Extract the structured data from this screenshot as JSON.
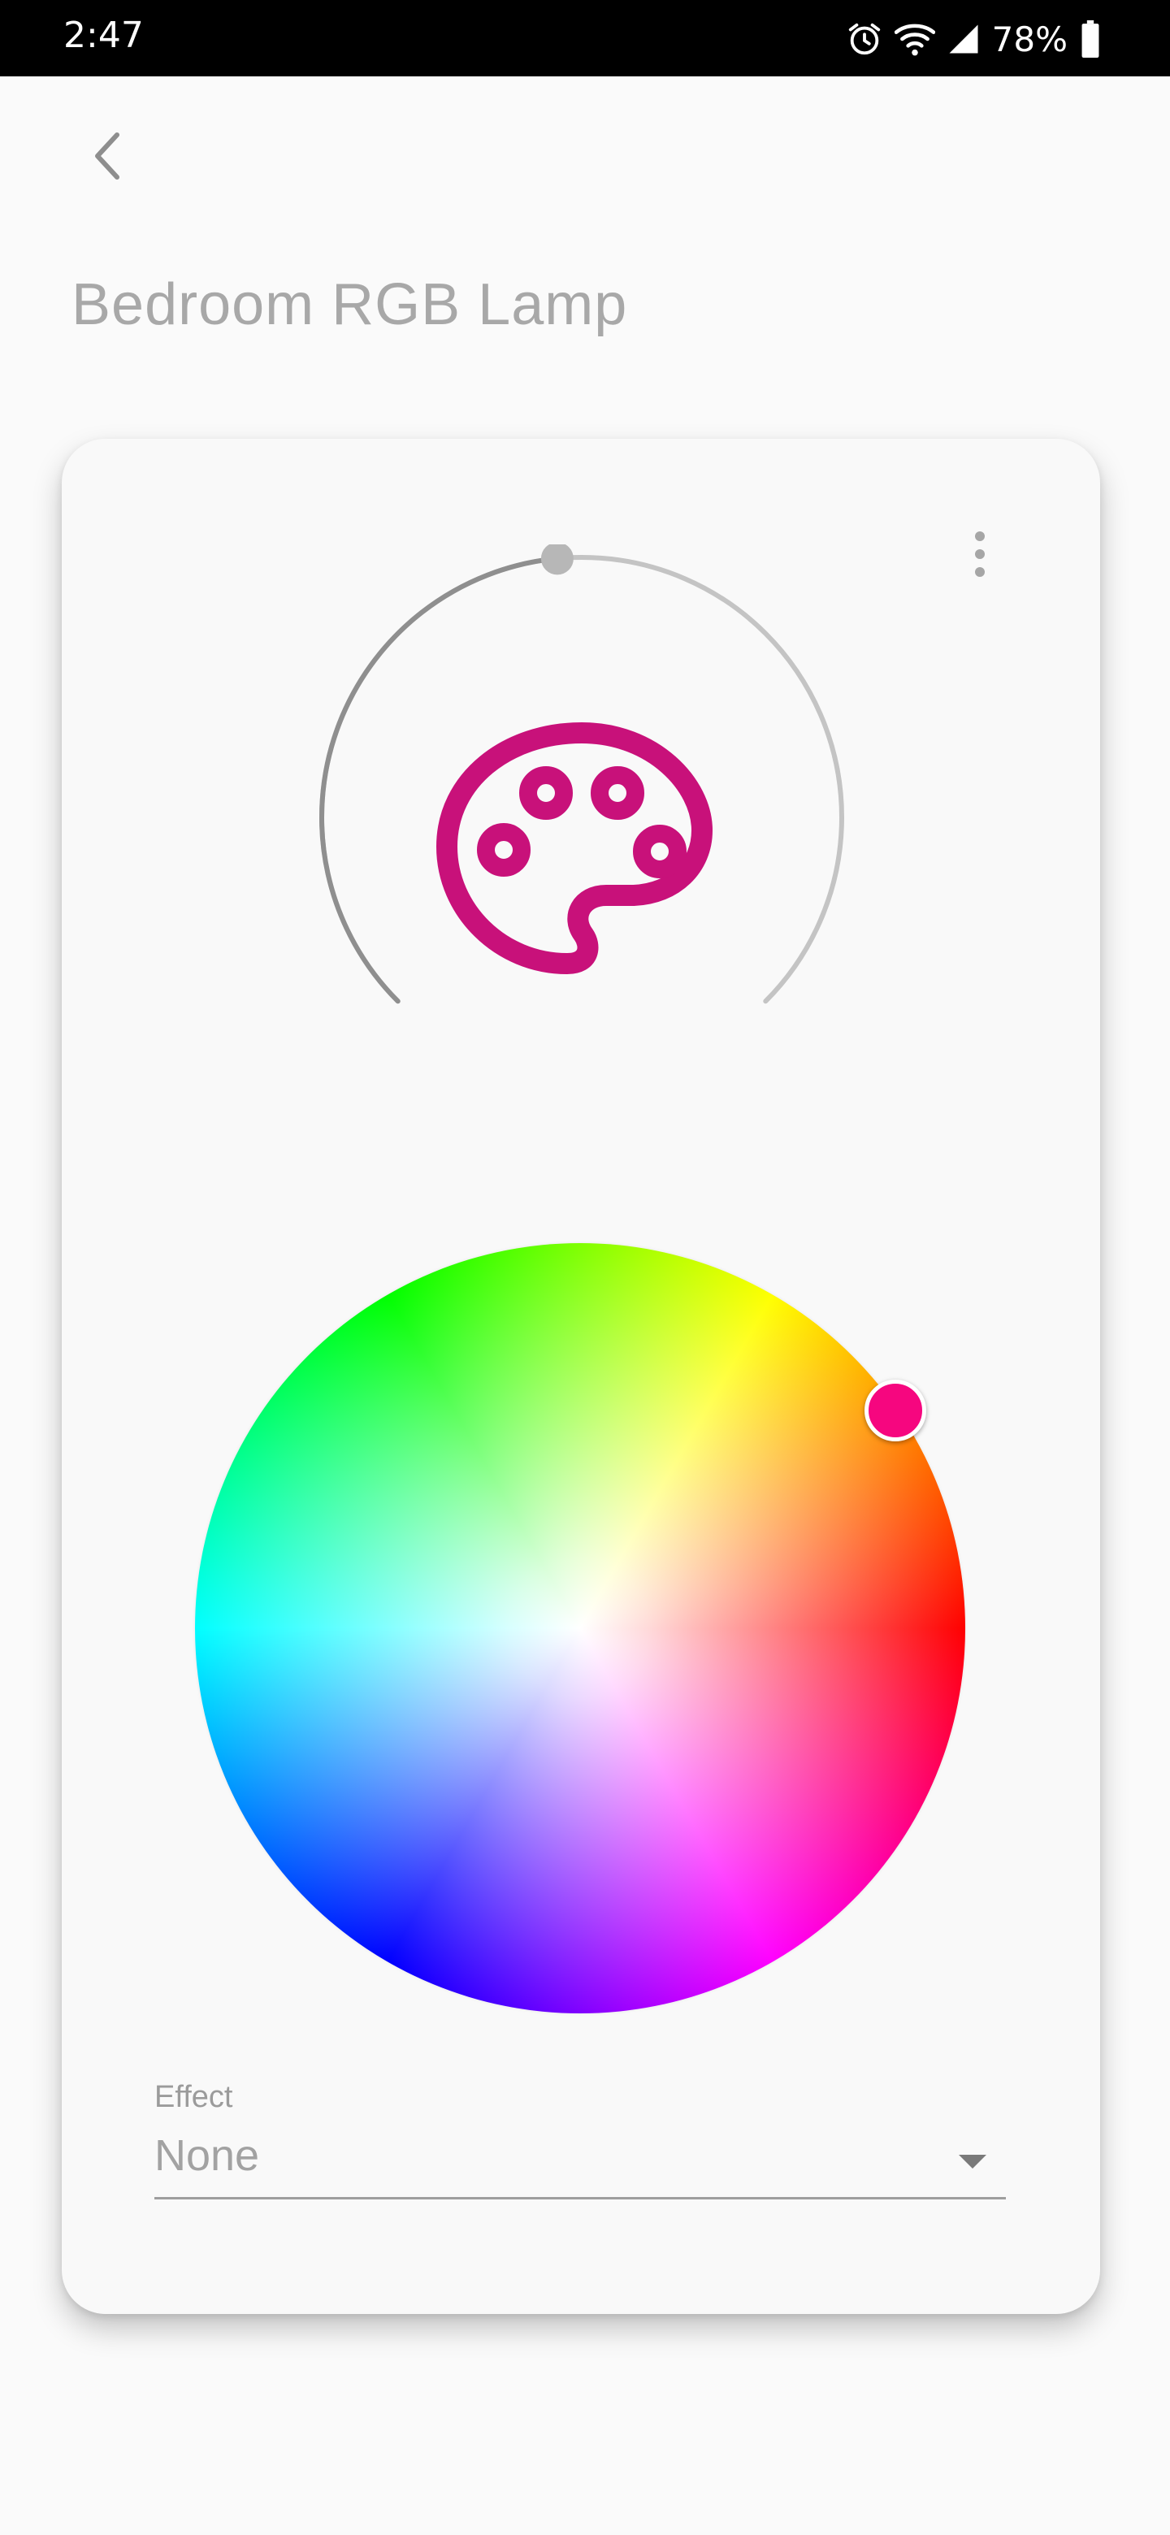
{
  "status_bar": {
    "time": "2:47",
    "battery": "78%",
    "icons": [
      "alarm-icon",
      "wifi-icon",
      "signal-icon",
      "battery-icon"
    ]
  },
  "header": {
    "back_icon": "chevron-left-icon",
    "title": "Bedroom RGB Lamp"
  },
  "card": {
    "menu_icon": "more-vertical-icon",
    "dial": {
      "icon": "palette-icon",
      "icon_color": "#c8117a",
      "level_fraction": 0.48,
      "track_color": "#c4c4c4",
      "active_color": "#8f8f8f"
    },
    "color_picker": {
      "selected_color": "#f6067f"
    },
    "effect": {
      "label": "Effect",
      "value": "None"
    }
  }
}
